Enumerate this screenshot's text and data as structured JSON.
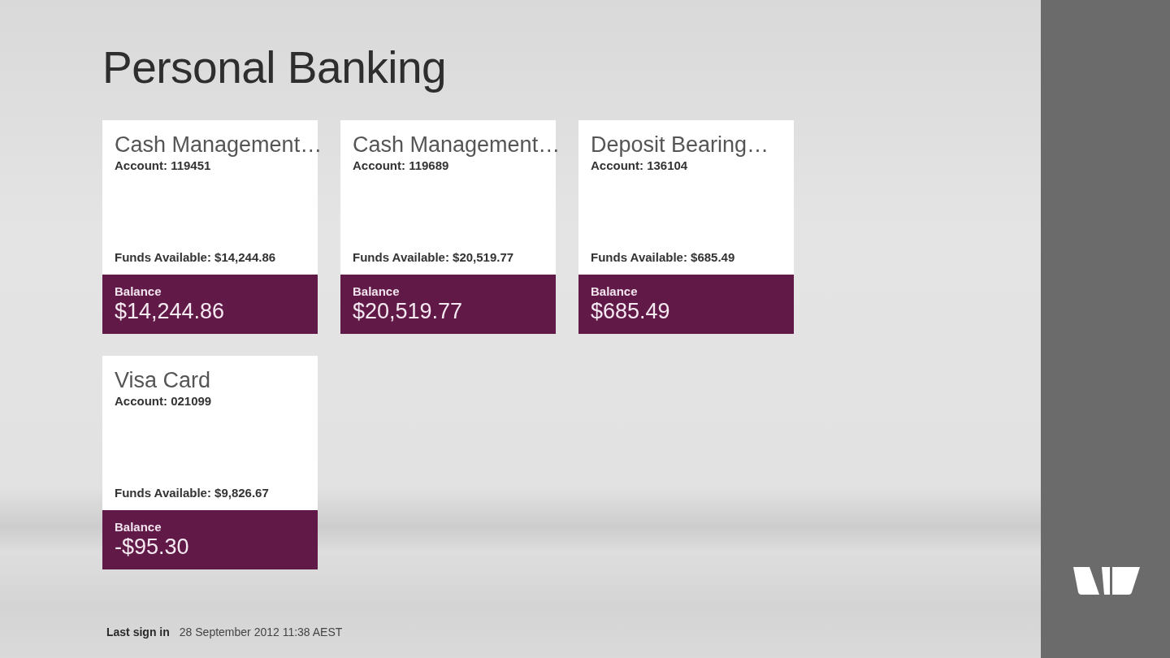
{
  "page": {
    "title": "Personal Banking"
  },
  "accounts": [
    {
      "name": "Cash Management…",
      "account": "Account: 119451",
      "funds_available": "Funds Available: $14,244.86",
      "balance_label": "Balance",
      "balance": "$14,244.86"
    },
    {
      "name": "Cash Management…",
      "account": "Account: 119689",
      "funds_available": "Funds Available: $20,519.77",
      "balance_label": "Balance",
      "balance": "$20,519.77"
    },
    {
      "name": "Deposit Bearing…",
      "account": "Account: 136104",
      "funds_available": "Funds Available: $685.49",
      "balance_label": "Balance",
      "balance": "$685.49"
    },
    {
      "name": "Visa Card",
      "account": "Account: 021099",
      "funds_available": "Funds Available: $9,826.67",
      "balance_label": "Balance",
      "balance": "-$95.30"
    }
  ],
  "footer": {
    "label": "Last sign in",
    "value": "28 September 2012 11:38 AEST"
  }
}
